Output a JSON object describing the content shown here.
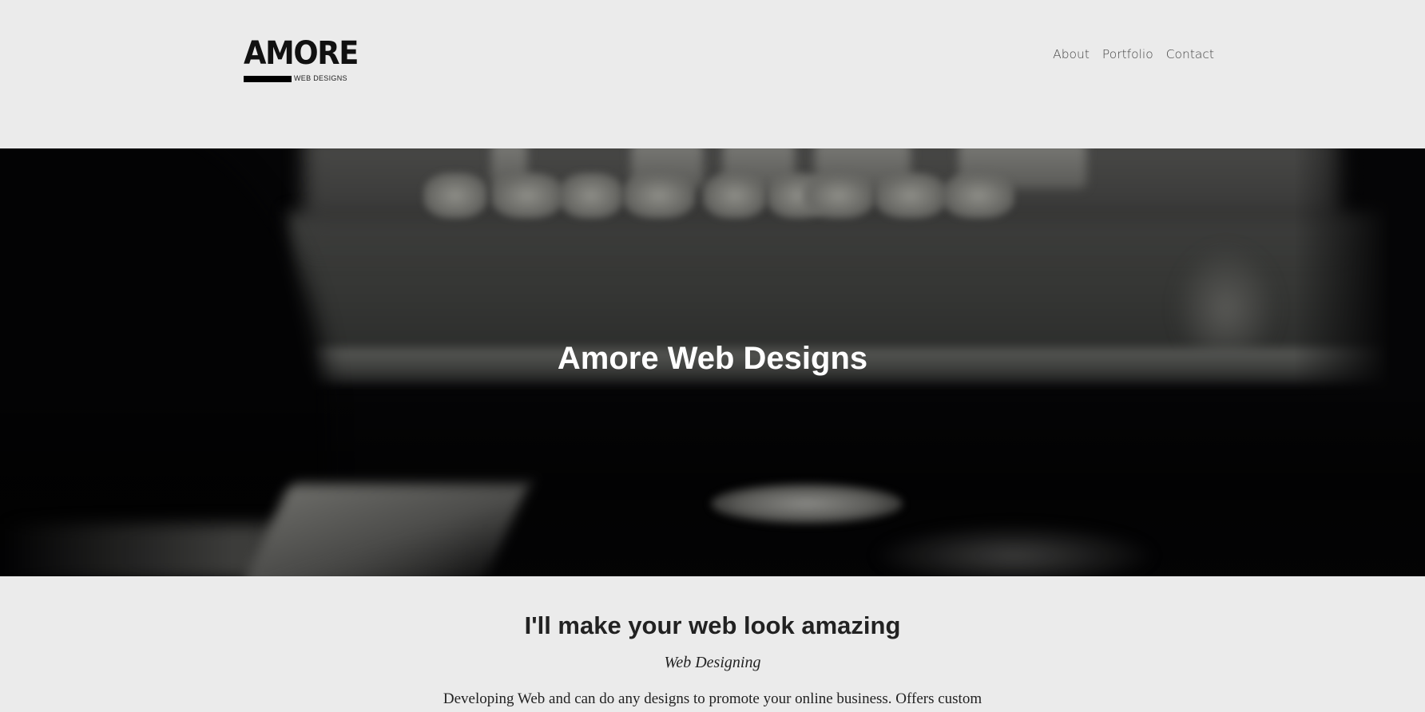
{
  "header": {
    "logo_text": "AMORE",
    "logo_subtext": "WEB DESIGNS",
    "nav": [
      {
        "label": "About"
      },
      {
        "label": "Portfolio"
      },
      {
        "label": "Contact"
      }
    ]
  },
  "hero": {
    "title": "Amore Web Designs"
  },
  "intro": {
    "heading": "I'll make your web look amazing",
    "subheading": "Web Designing",
    "body": "Developing Web and can do any designs to promote your online business. Offers custom"
  },
  "colors": {
    "page_background": "#ebebeb",
    "hero_background": "#050506",
    "hero_title": "#ffffff",
    "text": "#222222",
    "nav_text": "#444444"
  }
}
